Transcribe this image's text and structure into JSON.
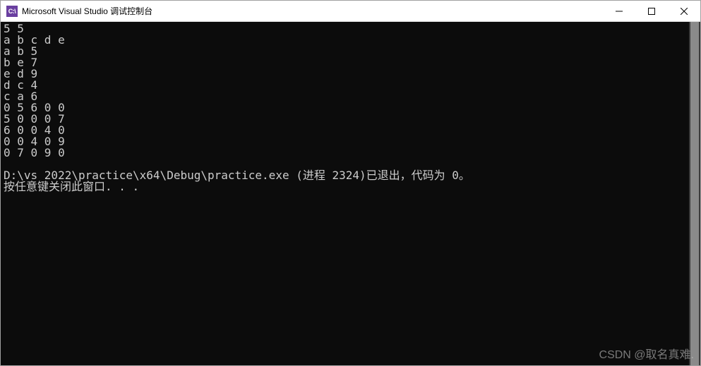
{
  "window": {
    "title": "Microsoft Visual Studio 调试控制台",
    "icon_label": "C:\\"
  },
  "console": {
    "lines": [
      "5 5",
      "a b c d e",
      "a b 5",
      "b e 7",
      "e d 9",
      "d c 4",
      "c a 6",
      "0 5 6 0 0",
      "5 0 0 0 7",
      "6 0 0 4 0",
      "0 0 4 0 9",
      "0 7 0 9 0",
      "",
      "D:\\vs 2022\\practice\\x64\\Debug\\practice.exe (进程 2324)已退出，代码为 0。",
      "按任意键关闭此窗口. . ."
    ]
  },
  "watermark": "CSDN @取名真难."
}
